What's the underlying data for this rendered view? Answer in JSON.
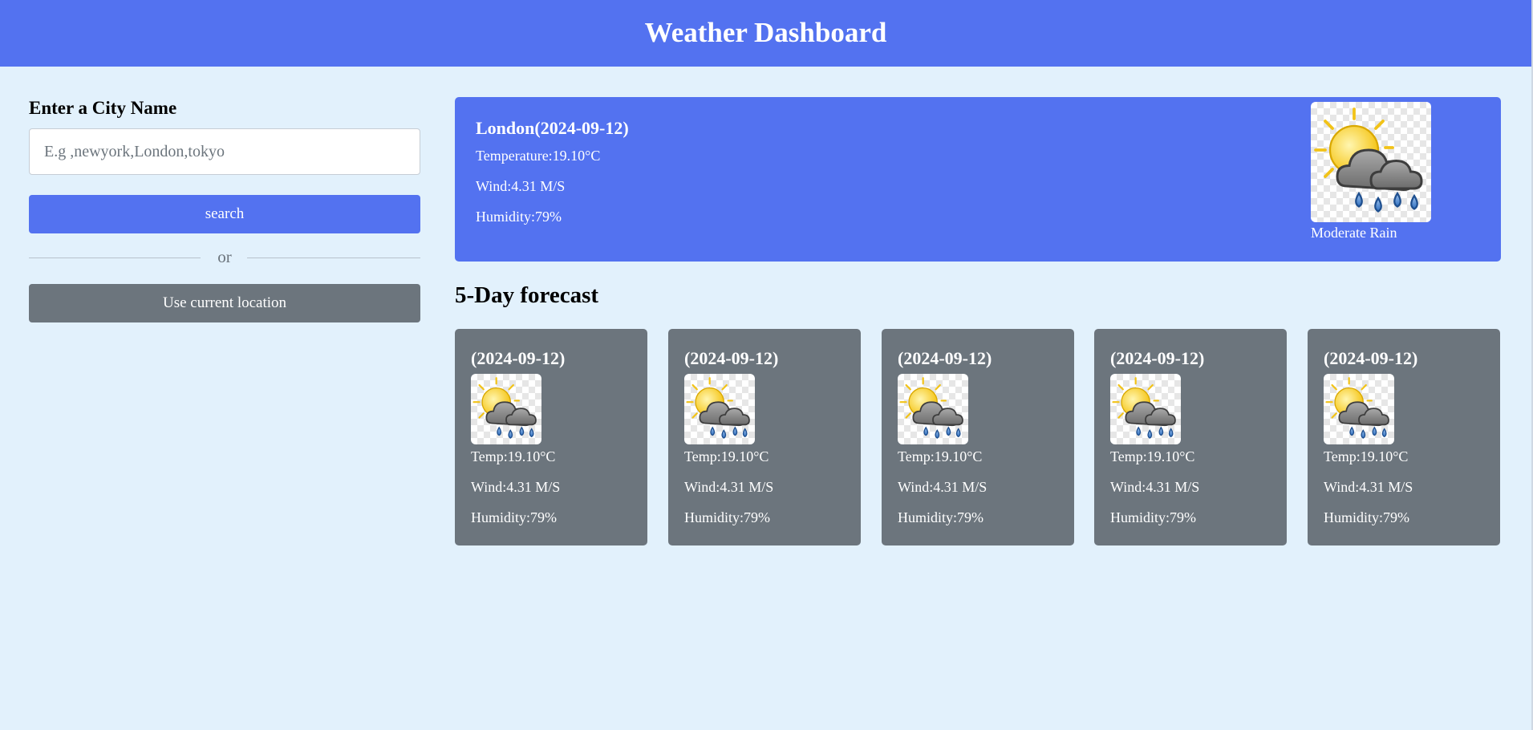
{
  "header": {
    "title": "Weather Dashboard"
  },
  "search": {
    "label": "Enter a City Name",
    "placeholder": "E.g ,newyork,London,tokyo",
    "value": "",
    "search_label": "search",
    "or_label": "or",
    "location_label": "Use current location"
  },
  "current": {
    "city": "London(2024-09-12)",
    "temperature": "Temperature:19.10°C",
    "wind": "Wind:4.31 M/S",
    "humidity": "Humidity:79%",
    "description": "Moderate Rain",
    "icon": "sun-cloud-rain-icon"
  },
  "forecast": {
    "title": "5-Day forecast",
    "days": [
      {
        "date": "(2024-09-12)",
        "temp": "Temp:19.10°C",
        "wind": "Wind:4.31 M/S",
        "humidity": "Humidity:79%",
        "icon": "sun-cloud-rain-icon"
      },
      {
        "date": "(2024-09-12)",
        "temp": "Temp:19.10°C",
        "wind": "Wind:4.31 M/S",
        "humidity": "Humidity:79%",
        "icon": "sun-cloud-rain-icon"
      },
      {
        "date": "(2024-09-12)",
        "temp": "Temp:19.10°C",
        "wind": "Wind:4.31 M/S",
        "humidity": "Humidity:79%",
        "icon": "sun-cloud-rain-icon"
      },
      {
        "date": "(2024-09-12)",
        "temp": "Temp:19.10°C",
        "wind": "Wind:4.31 M/S",
        "humidity": "Humidity:79%",
        "icon": "sun-cloud-rain-icon"
      },
      {
        "date": "(2024-09-12)",
        "temp": "Temp:19.10°C",
        "wind": "Wind:4.31 M/S",
        "humidity": "Humidity:79%",
        "icon": "sun-cloud-rain-icon"
      }
    ]
  },
  "colors": {
    "accent": "#5372f0",
    "secondary": "#6c757d",
    "background": "#e2f1fc"
  }
}
